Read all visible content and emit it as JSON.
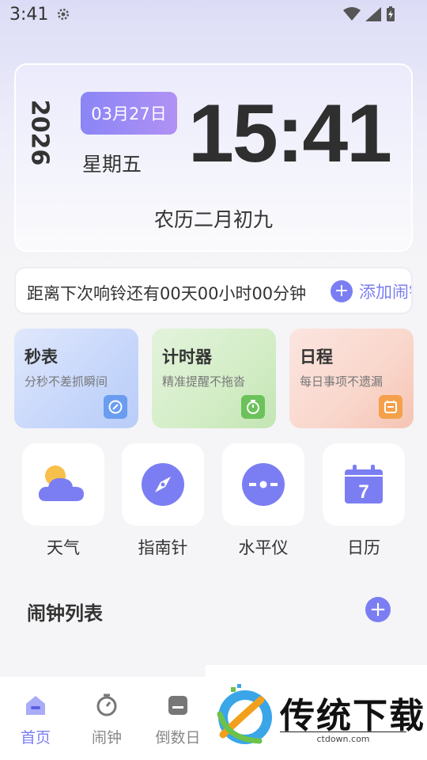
{
  "status_bar": {
    "time": "3:41"
  },
  "clock_card": {
    "year": "2026",
    "date": "03月27日",
    "weekday": "星期五",
    "time": "15:41",
    "lunar": "农历二月初九"
  },
  "countdown": {
    "text": "距离下次响铃还有00天00小时00分钟",
    "add_alarm_label": "添加闹钟"
  },
  "feature_cards": [
    {
      "title": "秒表",
      "subtitle": "分秒不差抓瞬间",
      "icon": "stopwatch-icon",
      "color": "#6a9cf0"
    },
    {
      "title": "计时器",
      "subtitle": "精准提醒不拖沓",
      "icon": "timer-icon",
      "color": "#6cc25a"
    },
    {
      "title": "日程",
      "subtitle": "每日事项不遗漏",
      "icon": "calendar-note-icon",
      "color": "#f5a04a"
    }
  ],
  "tools": [
    {
      "label": "天气",
      "icon": "weather-icon"
    },
    {
      "label": "指南针",
      "icon": "compass-icon"
    },
    {
      "label": "水平仪",
      "icon": "level-icon"
    },
    {
      "label": "日历",
      "icon": "calendar-icon",
      "calendar_day": "7"
    }
  ],
  "alarm_section": {
    "title": "闹钟列表"
  },
  "tabbar": [
    {
      "label": "首页",
      "icon": "home-icon",
      "active": true
    },
    {
      "label": "闹钟",
      "icon": "alarm-clock-icon",
      "active": false
    },
    {
      "label": "倒数日",
      "icon": "countdown-icon",
      "active": false
    }
  ],
  "watermark": {
    "title": "传统下载",
    "url": "ctdown.com"
  },
  "colors": {
    "accent": "#7b7ef2",
    "text": "#333333",
    "muted": "#777777"
  }
}
